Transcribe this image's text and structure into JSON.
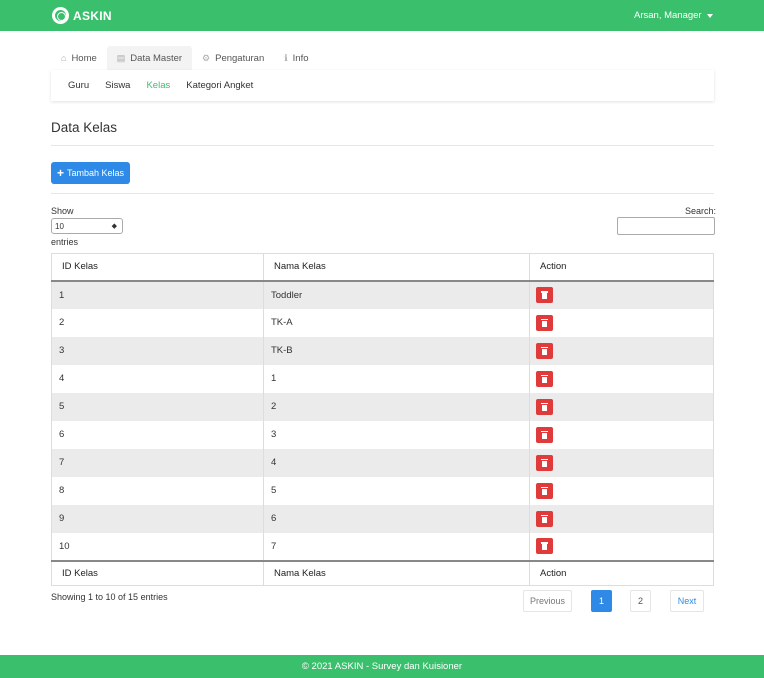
{
  "brand": {
    "name": "ASKIN"
  },
  "user": {
    "label": "Arsan, Manager"
  },
  "main_nav": [
    {
      "label": "Home",
      "icon": "home-icon",
      "glyph": "⌂",
      "active": false
    },
    {
      "label": "Data Master",
      "icon": "list-icon",
      "glyph": "▤",
      "active": true
    },
    {
      "label": "Pengaturan",
      "icon": "gears-icon",
      "glyph": "⚙",
      "active": false
    },
    {
      "label": "Info",
      "icon": "info-icon",
      "glyph": "ℹ",
      "active": false
    }
  ],
  "sub_nav": [
    {
      "label": "Guru",
      "active": false
    },
    {
      "label": "Siswa",
      "active": false
    },
    {
      "label": "Kelas",
      "active": true
    },
    {
      "label": "Kategori Angket",
      "active": false
    }
  ],
  "page": {
    "title": "Data Kelas",
    "add_button": "Tambah Kelas"
  },
  "table_controls": {
    "show_label": "Show",
    "entries_value": "10",
    "entries_label": "entries",
    "search_label": "Search:",
    "search_value": ""
  },
  "table": {
    "columns": [
      "ID Kelas",
      "Nama Kelas",
      "Action"
    ],
    "rows": [
      {
        "id": "1",
        "name": "Toddler"
      },
      {
        "id": "2",
        "name": "TK-A"
      },
      {
        "id": "3",
        "name": "TK-B"
      },
      {
        "id": "4",
        "name": "1"
      },
      {
        "id": "5",
        "name": "2"
      },
      {
        "id": "6",
        "name": "3"
      },
      {
        "id": "7",
        "name": "4"
      },
      {
        "id": "8",
        "name": "5"
      },
      {
        "id": "9",
        "name": "6"
      },
      {
        "id": "10",
        "name": "7"
      }
    ]
  },
  "pagination": {
    "info": "Showing 1 to 10 of 15 entries",
    "previous": "Previous",
    "pages": [
      "1",
      "2"
    ],
    "current": "1",
    "next": "Next"
  },
  "footer": {
    "text": "© 2021 ASKIN - Survey dan Kuisioner"
  },
  "colors": {
    "brand_green": "#3ac06c",
    "primary_blue": "#2e8ae6",
    "danger_red": "#e03a3a"
  }
}
